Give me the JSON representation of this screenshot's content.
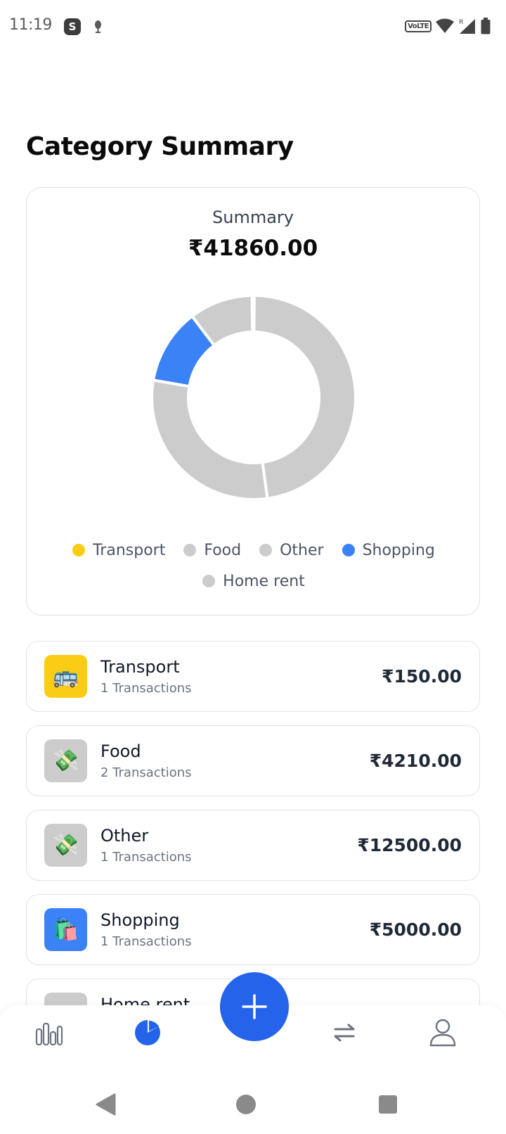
{
  "status_bar": {
    "time": "11:19",
    "app_icon_letter": "S",
    "network_label": "VoLTE",
    "roaming_label": "R"
  },
  "page": {
    "title": "Category Summary"
  },
  "summary": {
    "label": "Summary",
    "total": "₹41860.00"
  },
  "colors": {
    "transport": "#facc15",
    "food": "#cccccc",
    "other": "#cccccc",
    "shopping": "#3b82f6",
    "home_rent": "#cccccc",
    "accent": "#2563eb"
  },
  "chart_data": {
    "type": "pie",
    "categories": [
      "Transport",
      "Food",
      "Other",
      "Shopping",
      "Home rent"
    ],
    "values": [
      150,
      4210,
      12500,
      5000,
      20000
    ],
    "colors": [
      "#facc15",
      "#cccccc",
      "#cccccc",
      "#3b82f6",
      "#cccccc"
    ],
    "total": "₹41860.00",
    "legend_position": "bottom"
  },
  "legend": [
    {
      "label": "Transport",
      "color": "#facc15"
    },
    {
      "label": "Food",
      "color": "#cccccc"
    },
    {
      "label": "Other",
      "color": "#cccccc"
    },
    {
      "label": "Shopping",
      "color": "#3b82f6"
    },
    {
      "label": "Home rent",
      "color": "#cccccc"
    }
  ],
  "categories": [
    {
      "name": "Transport",
      "count": "1 Transactions",
      "amount": "₹150.00",
      "icon": "bus-icon",
      "emoji": "🚌",
      "icon_bg": "#facc15"
    },
    {
      "name": "Food",
      "count": "2 Transactions",
      "amount": "₹4210.00",
      "icon": "money-icon",
      "emoji": "💸",
      "icon_bg": "#cccccc"
    },
    {
      "name": "Other",
      "count": "1 Transactions",
      "amount": "₹12500.00",
      "icon": "money-icon",
      "emoji": "💸",
      "icon_bg": "#cccccc"
    },
    {
      "name": "Shopping",
      "count": "1 Transactions",
      "amount": "₹5000.00",
      "icon": "shopping-bags-icon",
      "emoji": "🛍️",
      "icon_bg": "#3b82f6"
    },
    {
      "name": "Home rent",
      "count": "",
      "amount": "",
      "icon": "home-icon",
      "emoji": "",
      "icon_bg": "#cccccc"
    }
  ],
  "bottom_nav": {
    "items": [
      "stats-icon",
      "pie-chart-icon",
      "add-icon",
      "transfer-icon",
      "profile-icon"
    ],
    "active": "pie-chart-icon"
  },
  "system_nav": {
    "items": [
      "back-icon",
      "home-icon",
      "recents-icon"
    ]
  }
}
